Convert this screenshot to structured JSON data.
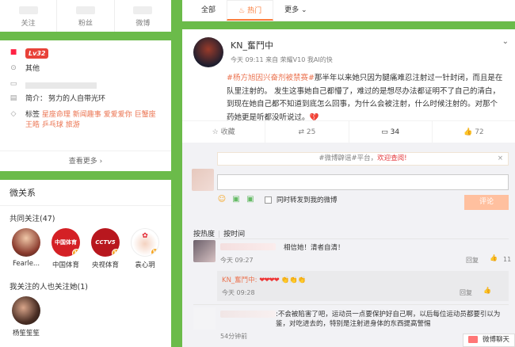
{
  "profile_stats": [
    {
      "label": "关注"
    },
    {
      "label": "粉丝"
    },
    {
      "label": "微博"
    }
  ],
  "info": {
    "level": "Lv32",
    "location": "其他",
    "intro_label": "简介：",
    "intro": "努力的人自带光环",
    "tags_label": "标签",
    "tags": [
      "星座命理",
      "新闻趣事",
      "爱爱爱你",
      "巨蟹座",
      "王皓",
      "乒乓球",
      "旅游"
    ],
    "view_more": "查看更多 ›"
  },
  "relations": {
    "title": "微关系",
    "mutual_title": "共同关注(47)",
    "mutual": [
      {
        "name": "Fearle...",
        "color": "#c24f3c"
      },
      {
        "name": "中国体育",
        "color": "#d42025",
        "logo": "中国体育"
      },
      {
        "name": "央视体育",
        "color": "#b8171e",
        "logo": "CCTV5"
      },
      {
        "name": "袁心玥",
        "color": "#ffffff"
      }
    ],
    "followed_title": "我关注的人也关注她(1)",
    "followed": [
      {
        "name": "杨笙笙笙",
        "color": "#3a2a22"
      }
    ]
  },
  "tabs": {
    "all": "全部",
    "hot": "热门",
    "more": "更多"
  },
  "post": {
    "author": "KN_奮鬥中",
    "meta": "今天 09:11 来自 荣耀V10 我AI的快",
    "hashtag": "#杨方旭因兴奋剂被禁赛#",
    "body": "那半年以来她只因为腿痛难忍注射过一针封闭，而且是在队里注射的。 发生这事她自己都懵了，难过的是想尽办法都证明不了自己的清白，到现在她自己都不知道到底怎么回事，为什么会被注射，什么时候注射的。对那个药她更是听都没听说过。",
    "emoji": "💔",
    "actions": {
      "collect": "收藏",
      "repost": "25",
      "comment": "34",
      "like": "72"
    }
  },
  "comments_area": {
    "notice_prefix": "#微博辟谣#平台，",
    "notice_link": "欢迎查阅!",
    "sync_label": "同时转发到我的微博",
    "submit": "评论",
    "sort_hot": "按热度",
    "sort_time": "按时间",
    "comments": [
      {
        "text": "相信她！清者自清！",
        "time": "今天 09:27",
        "reply_label": "回复",
        "likes": "11",
        "reply": {
          "author": "KN_奮鬥中:",
          "hearts": "❤❤❤❤",
          "claps": "👏👏👏",
          "time": "今天 09:28",
          "reply_label": "回复"
        }
      },
      {
        "text": ":不会被陷害了吧，运动员一点要保护好自己啊，以后每位运动员都要引以为鉴，对吃进去的，特别是注射进身体的东西提高警惕",
        "time": "54分钟前"
      }
    ]
  },
  "chat": "微博聊天"
}
